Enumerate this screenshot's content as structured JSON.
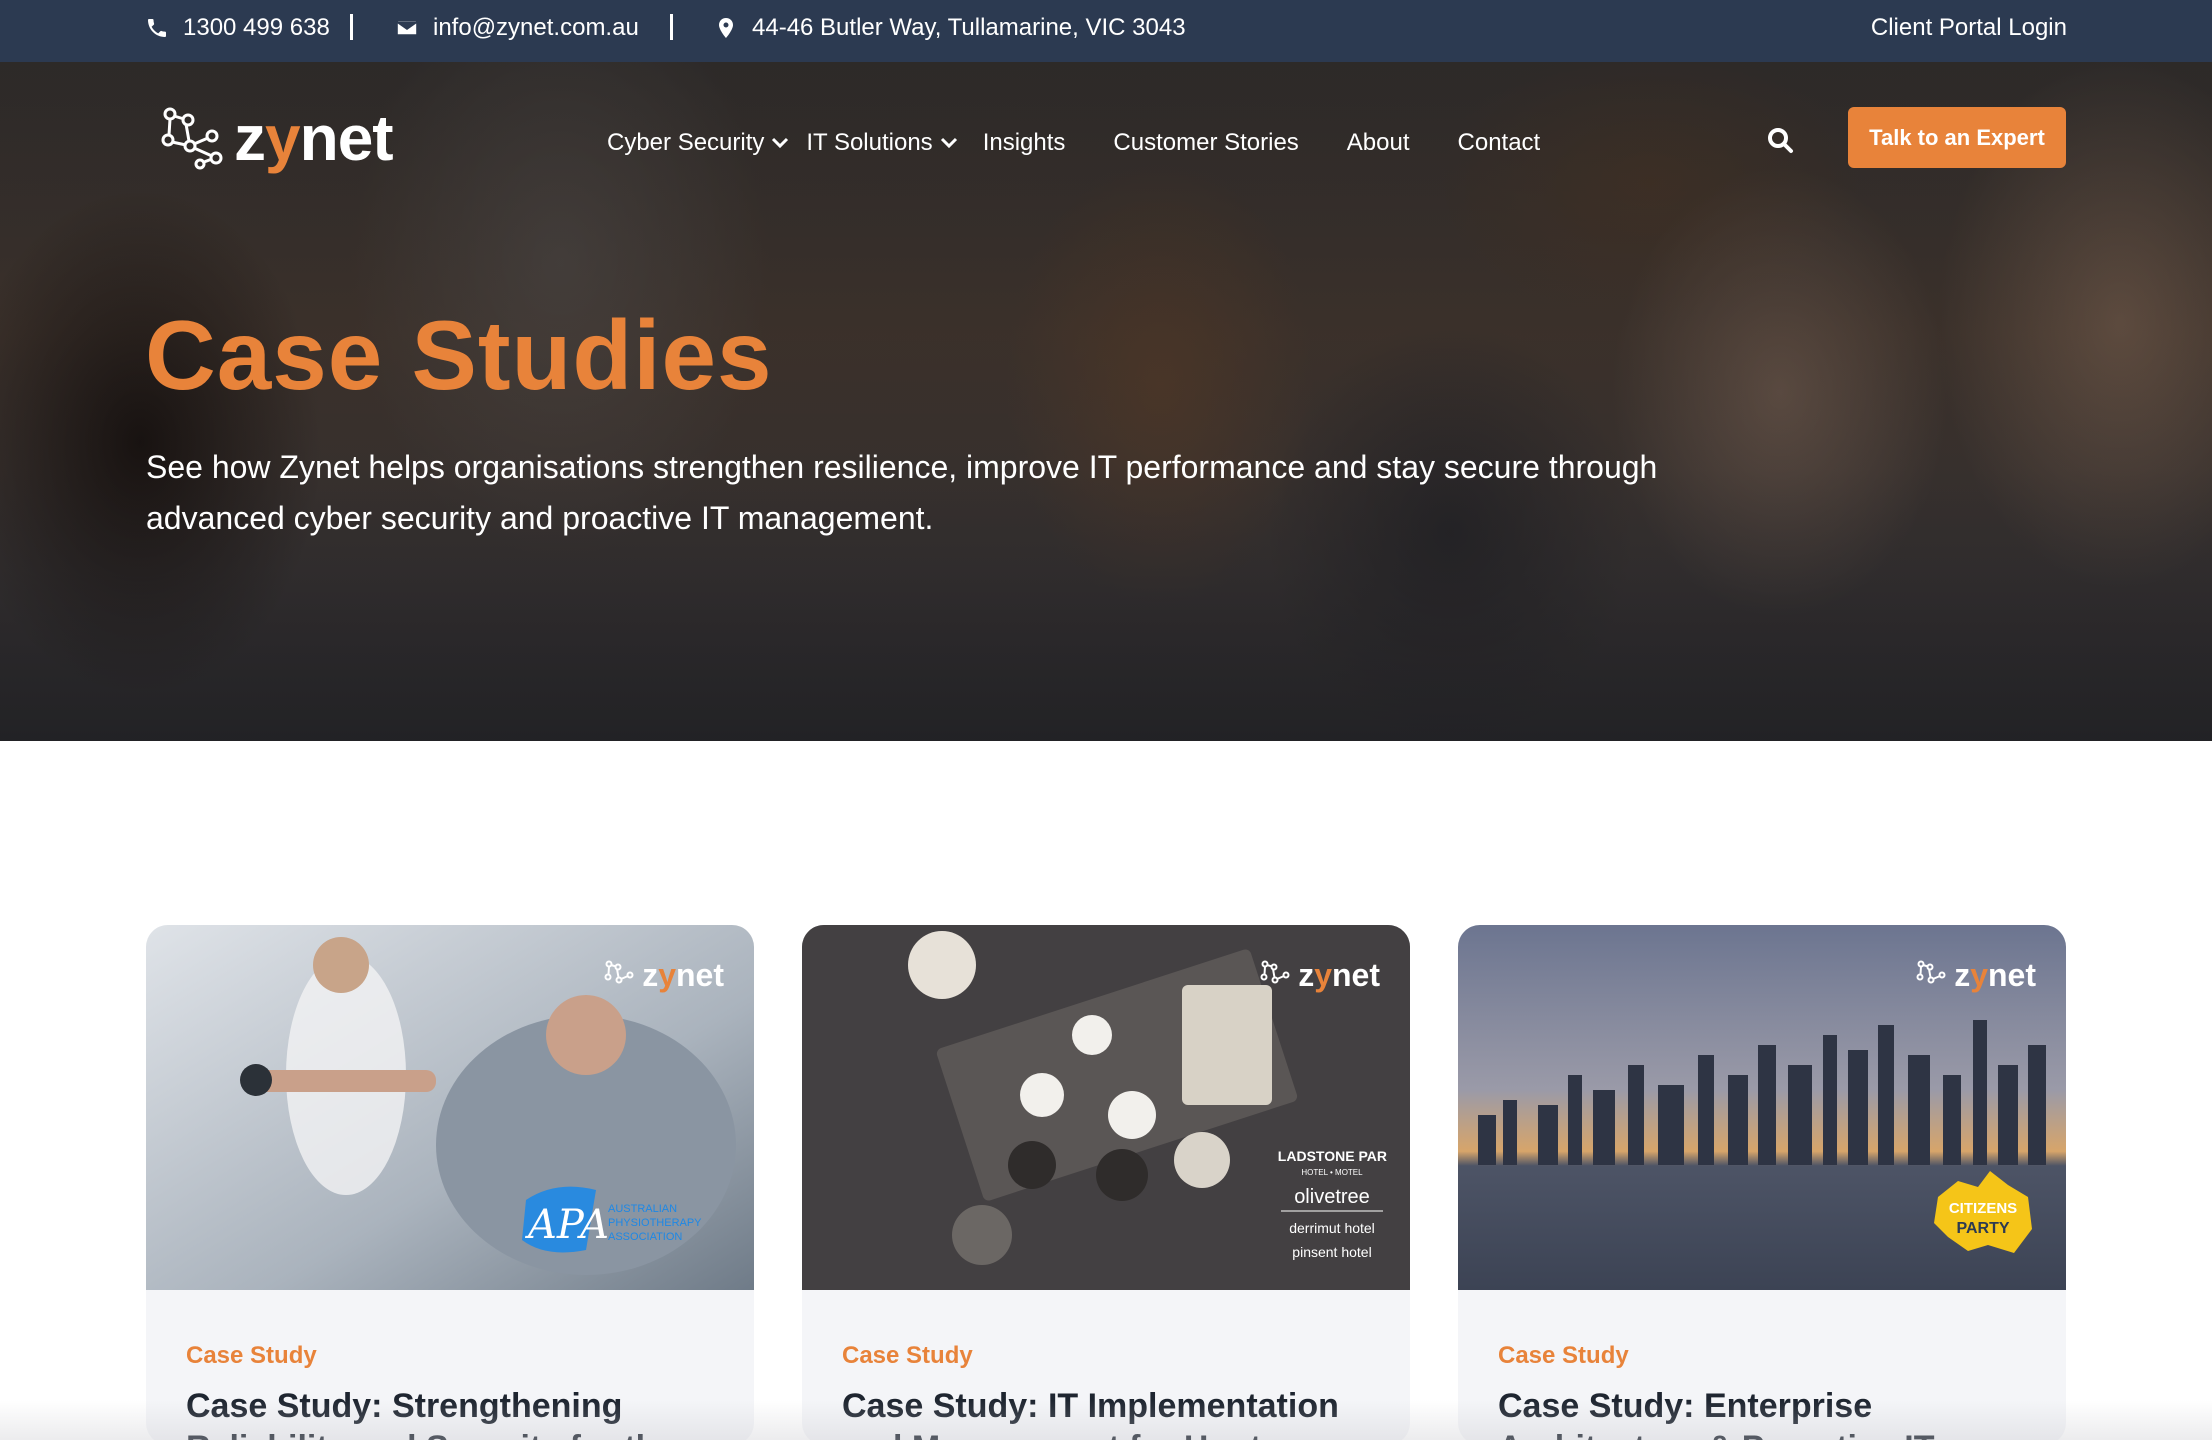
{
  "topbar": {
    "phone": "1300 499 638",
    "email": "info@zynet.com.au",
    "address": "44-46 Butler Way, Tullamarine, VIC 3043",
    "portal_label": "Client Portal Login"
  },
  "header": {
    "logo_text_a": "z",
    "logo_text_y": "y",
    "logo_text_b": "net",
    "nav": [
      {
        "label": "Cyber Security",
        "dropdown": true
      },
      {
        "label": "IT Solutions",
        "dropdown": true
      },
      {
        "label": "Insights",
        "dropdown": false
      },
      {
        "label": "Customer Stories",
        "dropdown": false
      },
      {
        "label": "About",
        "dropdown": false
      },
      {
        "label": "Contact",
        "dropdown": false
      }
    ],
    "search_icon": "search-icon",
    "cta_label": "Talk to an Expert"
  },
  "hero": {
    "title": "Case Studies",
    "subtitle": "See how Zynet helps organisations strengthen resilience, improve IT performance and stay secure through advanced cyber security and proactive IT management."
  },
  "cards": [
    {
      "tag": "Case Study",
      "title": "Case Study: Strengthening Reliability and Security for the",
      "partner_logo": "APA",
      "partner_text": "AUSTRALIAN PHYSIOTHERAPY ASSOCIATION"
    },
    {
      "tag": "Case Study",
      "title": "Case Study: IT Implementation and Management for Hunter",
      "partner_logos": [
        "GLADSTONE PARK",
        "HOTEL • MOTEL",
        "olivetree",
        "derrimut hotel",
        "pinsent hotel"
      ]
    },
    {
      "tag": "Case Study",
      "title": "Case Study: Enterprise Architecture & Proactive IT",
      "partner_logo": "CITIZENS PARTY"
    }
  ],
  "colors": {
    "brand_orange": "#e8833a",
    "topbar_navy": "#2c3a51",
    "card_bg": "#f4f5f8",
    "heading_dark": "#1e2530"
  }
}
